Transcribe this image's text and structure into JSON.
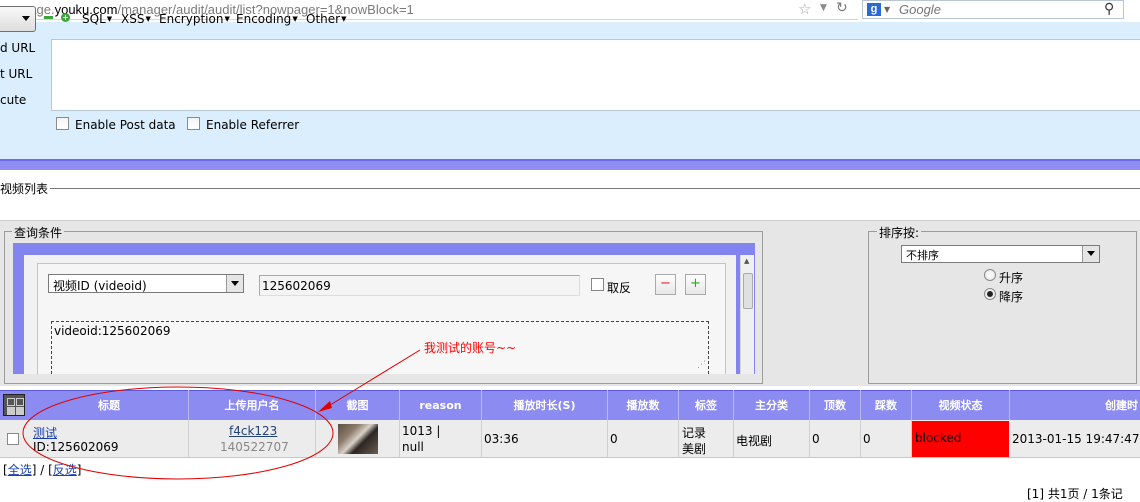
{
  "browser": {
    "url_prefix": "manage.",
    "url_domain": "youku.com",
    "url_path": "/manager/audit/audit/list?nowpager=1&nowBlock=1",
    "search_placeholder": "Google",
    "search_engine_letter": "g"
  },
  "hackbar": {
    "menus": [
      "SQL",
      "XSS",
      "Encryption",
      "Encoding",
      "Other"
    ],
    "labels": [
      "d URL",
      "t URL",
      "cute"
    ],
    "checkbox_post": "Enable Post data",
    "checkbox_referrer": "Enable Referrer"
  },
  "page": {
    "section_title": "视频列表",
    "query": {
      "legend": "查询条件",
      "field_selected": "视频ID (videoid)",
      "field_value": "125602069",
      "negate_label": "取反",
      "minus_label": "−",
      "plus_label": "+",
      "condition_text": "videoid:125602069"
    },
    "sort": {
      "legend": "排序按:",
      "selected": "不排序",
      "asc_label": "升序",
      "desc_label": "降序",
      "selected_order": "desc"
    },
    "annotation": "我测试的账号~~"
  },
  "table": {
    "headers": {
      "title": "标题",
      "uploader": "上传用户名",
      "screenshot": "截图",
      "reason": "reason",
      "duration": "播放时长(S)",
      "plays": "播放数",
      "tags": "标签",
      "category": "主分类",
      "up": "顶数",
      "down": "踩数",
      "status": "视频状态",
      "created": "创建时"
    },
    "row": {
      "title_link": "测试",
      "video_id": "ID:125602069",
      "uploader_name": "f4ck123",
      "uploader_id": "140522707",
      "reason_line1": "1013 |",
      "reason_line2": "null",
      "duration": "03:36",
      "plays": "0",
      "tag1": "记录",
      "tag2": "美剧",
      "category": "电视剧",
      "up": "0",
      "down": "0",
      "status": "blocked",
      "created": "2013-01-15 19:47:47"
    },
    "select_all": "全选",
    "separator": " / ",
    "invert_select": "反选",
    "pager": "[1]  共1页 / 1条记"
  },
  "colors": {
    "hackbar_bg": "#dbeefe",
    "table_header": "#8b8bf2",
    "blocked": "#ff0000",
    "annotation": "#ff0000"
  }
}
